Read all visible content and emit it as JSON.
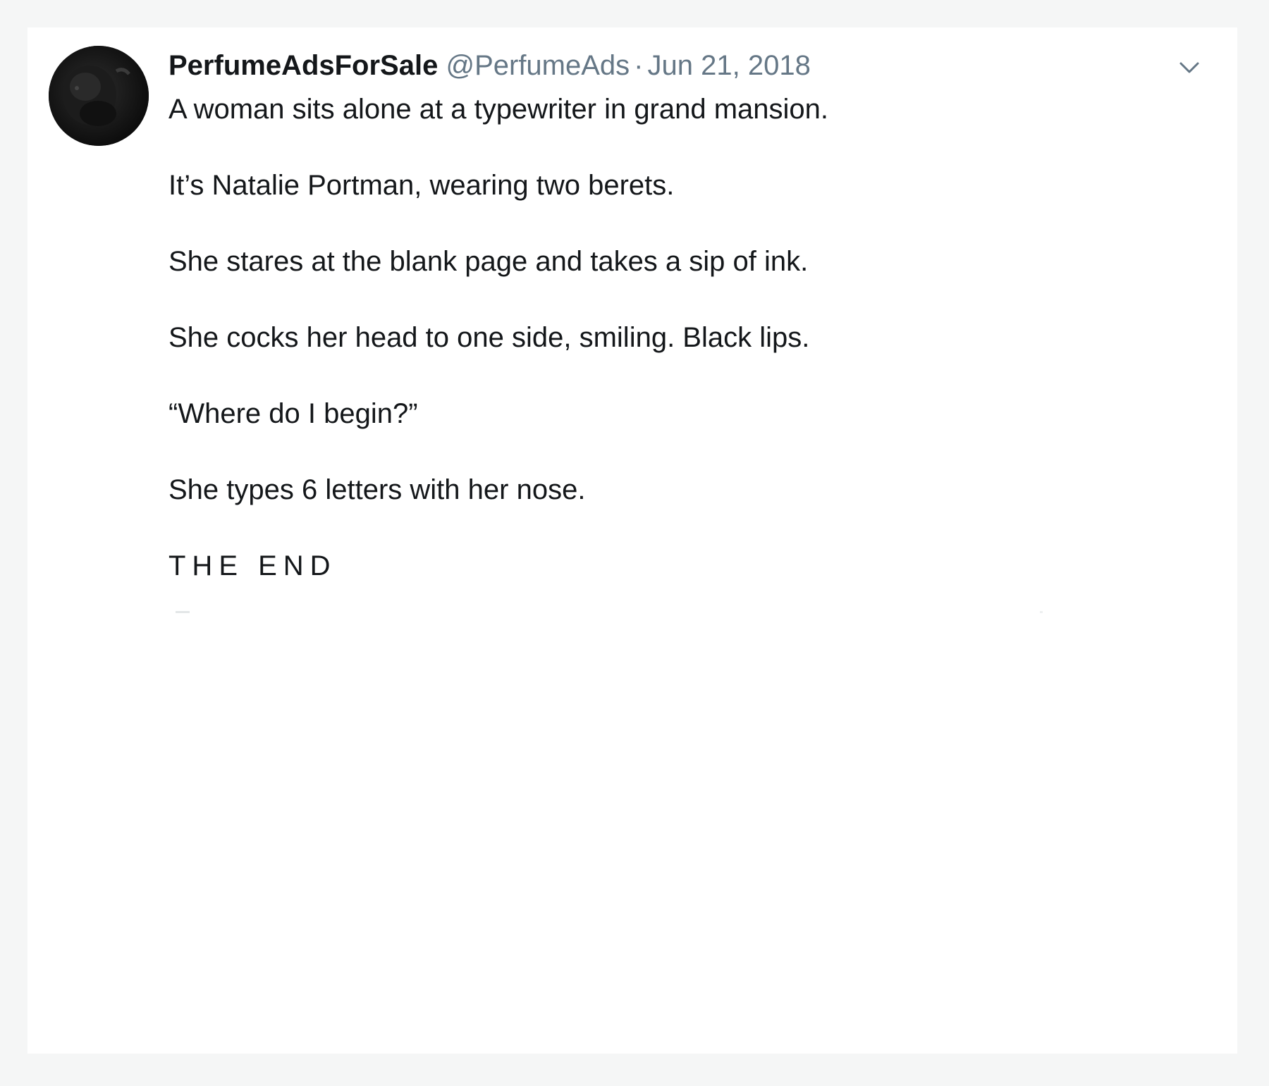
{
  "tweet": {
    "author": {
      "display_name": "PerfumeAdsForSale",
      "handle": "@PerfumeAds",
      "avatar_icon": "bison-avatar"
    },
    "separator": "·",
    "date": "Jun 21, 2018",
    "menu_icon": "chevron-down-icon",
    "paragraphs": [
      "A woman sits alone at a typewriter in grand mansion.",
      "It’s Natalie Portman, wearing two berets.",
      "She stares at the blank page and takes a sip of ink.",
      "She cocks her head to one side, smiling. Black lips.",
      "“Where do I begin?”",
      "She types 6 letters with her nose."
    ],
    "closing": "THE END"
  },
  "colors": {
    "page_background": "#f5f6f6",
    "card_background": "#ffffff",
    "text_primary": "#14171a",
    "text_secondary": "#657786"
  }
}
